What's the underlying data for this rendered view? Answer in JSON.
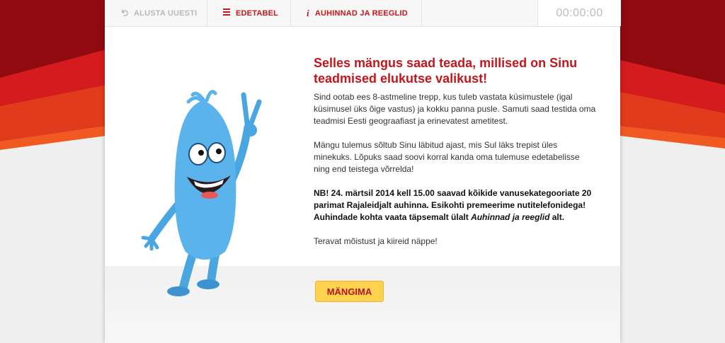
{
  "colors": {
    "brand_red": "#c4161c",
    "button_yellow": "#ffd24f",
    "timer_gray": "#bdbdbd"
  },
  "nav": {
    "restart": {
      "label": "ALUSTA UUESTI",
      "icon": "undo-arrow-icon"
    },
    "leaderboard": {
      "label": "EDETABEL",
      "icon": "list-icon"
    },
    "prizes": {
      "label": "AUHINNAD JA REEGLID",
      "icon": "info-icon"
    }
  },
  "timer": "00:00:00",
  "intro": {
    "title": "Selles mängus saad teada, millised on Sinu teadmised elukutse valikust!",
    "p1": "Sind ootab ees 8-astmeline trepp, kus tuleb vastata küsimustele (igal küsimusel üks õige vastus) ja kokku panna pusle. Samuti saad testida oma teadmisi Eesti geograafiast ja erinevatest ametitest.",
    "p2": "Mängu tulemus sõltub Sinu läbitud ajast, mis Sul läks trepist üles minekuks. Lõpuks saad soovi korral kanda oma tulemuse edetabelisse ning end teistega võrrelda!",
    "p3_main": "NB! 24. märtsil 2014 kell 15.00 saavad kõikide vanusekategooriate 20 parimat Rajaleidjalt auhinna. Esikohti premeerime nutitelefonidega! Auhindade kohta vaata täpsemalt ülalt ",
    "p3_italic": "Auhinnad ja reeglid",
    "p3_end": " alt.",
    "p4": "Teravat mõistust ja kiireid näppe!"
  },
  "play_button": "MÄNGIMA",
  "mascot": {
    "icon": "blue-mascot-waving-icon"
  }
}
